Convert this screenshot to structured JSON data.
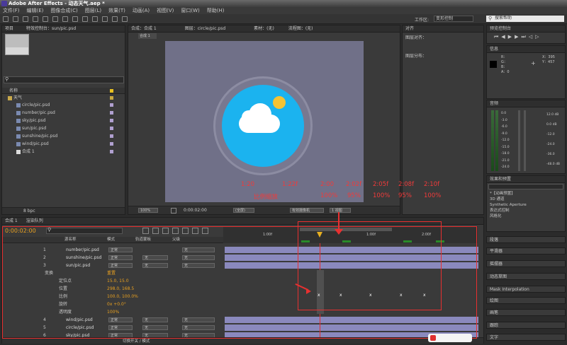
{
  "title": "Adobe After Effects - 动态天气.aep *",
  "menu": [
    "文件(F)",
    "编辑(E)",
    "图像合成(C)",
    "图层(L)",
    "效果(T)",
    "动画(A)",
    "视图(V)",
    "窗口(W)",
    "帮助(H)"
  ],
  "toolbar": {
    "workspace_label": "工作区:",
    "workspace_value": "变形控制",
    "search_placeholder": "搜索帮助"
  },
  "project": {
    "tab": "项目",
    "effects_tab": "特效控制台：sun/pic.psd",
    "col_name": "名称",
    "folder": "天气",
    "items": [
      "circle/pic.psd",
      "number/pic.psd",
      "sky/pic.psd",
      "sun/pic.psd",
      "sunshine/pic.psd",
      "wind/pic.psd",
      "合成 1"
    ],
    "bpc": "8 bpc"
  },
  "viewer": {
    "tab": "合成：合成 1",
    "layer_tab": "图层：circle/pic.psd",
    "footage_tab": "素材：(无)",
    "flow_tab": "流程图：(无)",
    "comp_label": "合成 1",
    "zoom": "100%",
    "time": "0:00:02:00",
    "quality": "(全屏)",
    "camera": "有效摄像机",
    "views": "1 视图"
  },
  "align": {
    "tab": "对齐",
    "align_label": "图层对齐：",
    "distribute_label": "图层分布："
  },
  "preview": {
    "tab": "预览控制台"
  },
  "info": {
    "tab": "信息",
    "r": "R：",
    "g": "G：",
    "b": "B：",
    "a": "A：0",
    "x": "X：395",
    "y": "Y：457"
  },
  "audio": {
    "tab": "音频",
    "levels": [
      "0.0",
      "-3.0",
      "-6.0",
      "-9.0",
      "-12.0",
      "-15.0",
      "-18.0",
      "-21.0",
      "-24.0"
    ],
    "db": [
      "12.0 dB",
      "0.0 dB",
      "-12.0",
      "-24.0",
      "-36.0",
      "-48.0 dB"
    ]
  },
  "effects": {
    "tab": "效果和预置",
    "items": [
      "*【动画预置】",
      "3D 通道",
      "Synthetic Aperture",
      "表达式控制",
      "风格化"
    ]
  },
  "right_panels": [
    "段落",
    "平滑器",
    "摇摆器",
    "动态草图",
    "Mask Interpolation",
    "绘图",
    "画笔",
    "跟踪",
    "文字"
  ],
  "timeline": {
    "tab": "合成 1",
    "render_tab": "渲染队列",
    "time": "0:00:02:00",
    "col_source": "源名称",
    "col_mode": "模式",
    "col_trkmat": "轨道蒙板",
    "col_parent": "父级",
    "ruler": [
      "1:00f",
      "",
      "1:00f",
      "",
      "2:00f"
    ],
    "layers": [
      {
        "n": "1",
        "name": "number/pic.psd"
      },
      {
        "n": "2",
        "name": "sunshine/pic.psd"
      },
      {
        "n": "3",
        "name": "sun/pic.psd"
      }
    ],
    "transform": {
      "label": "变换",
      "reset": "重置",
      "props": [
        {
          "name": "定位点",
          "val": "15.0, 15.0"
        },
        {
          "name": "位置",
          "val": "298.0, 168.5"
        },
        {
          "name": "比例",
          "val": "100.0, 100.0%"
        },
        {
          "name": "旋转",
          "val": "0x +0.0°"
        },
        {
          "name": "透明度",
          "val": "100%"
        }
      ]
    },
    "layers2": [
      {
        "n": "4",
        "name": "wind/pic.psd"
      },
      {
        "n": "5",
        "name": "circle/pic.psd"
      },
      {
        "n": "6",
        "name": "sky/pic.psd"
      }
    ],
    "mode": "正常",
    "none": "无",
    "footer": "切换开关 / 模式"
  },
  "annotation": {
    "times": [
      "1:20",
      "1:22f",
      "2:00",
      "2:02f",
      "2:05f",
      "2:08f",
      "2:10f"
    ],
    "scales": [
      "比例缩放",
      "100%",
      "95%",
      "100%",
      "95%",
      "100%"
    ]
  }
}
